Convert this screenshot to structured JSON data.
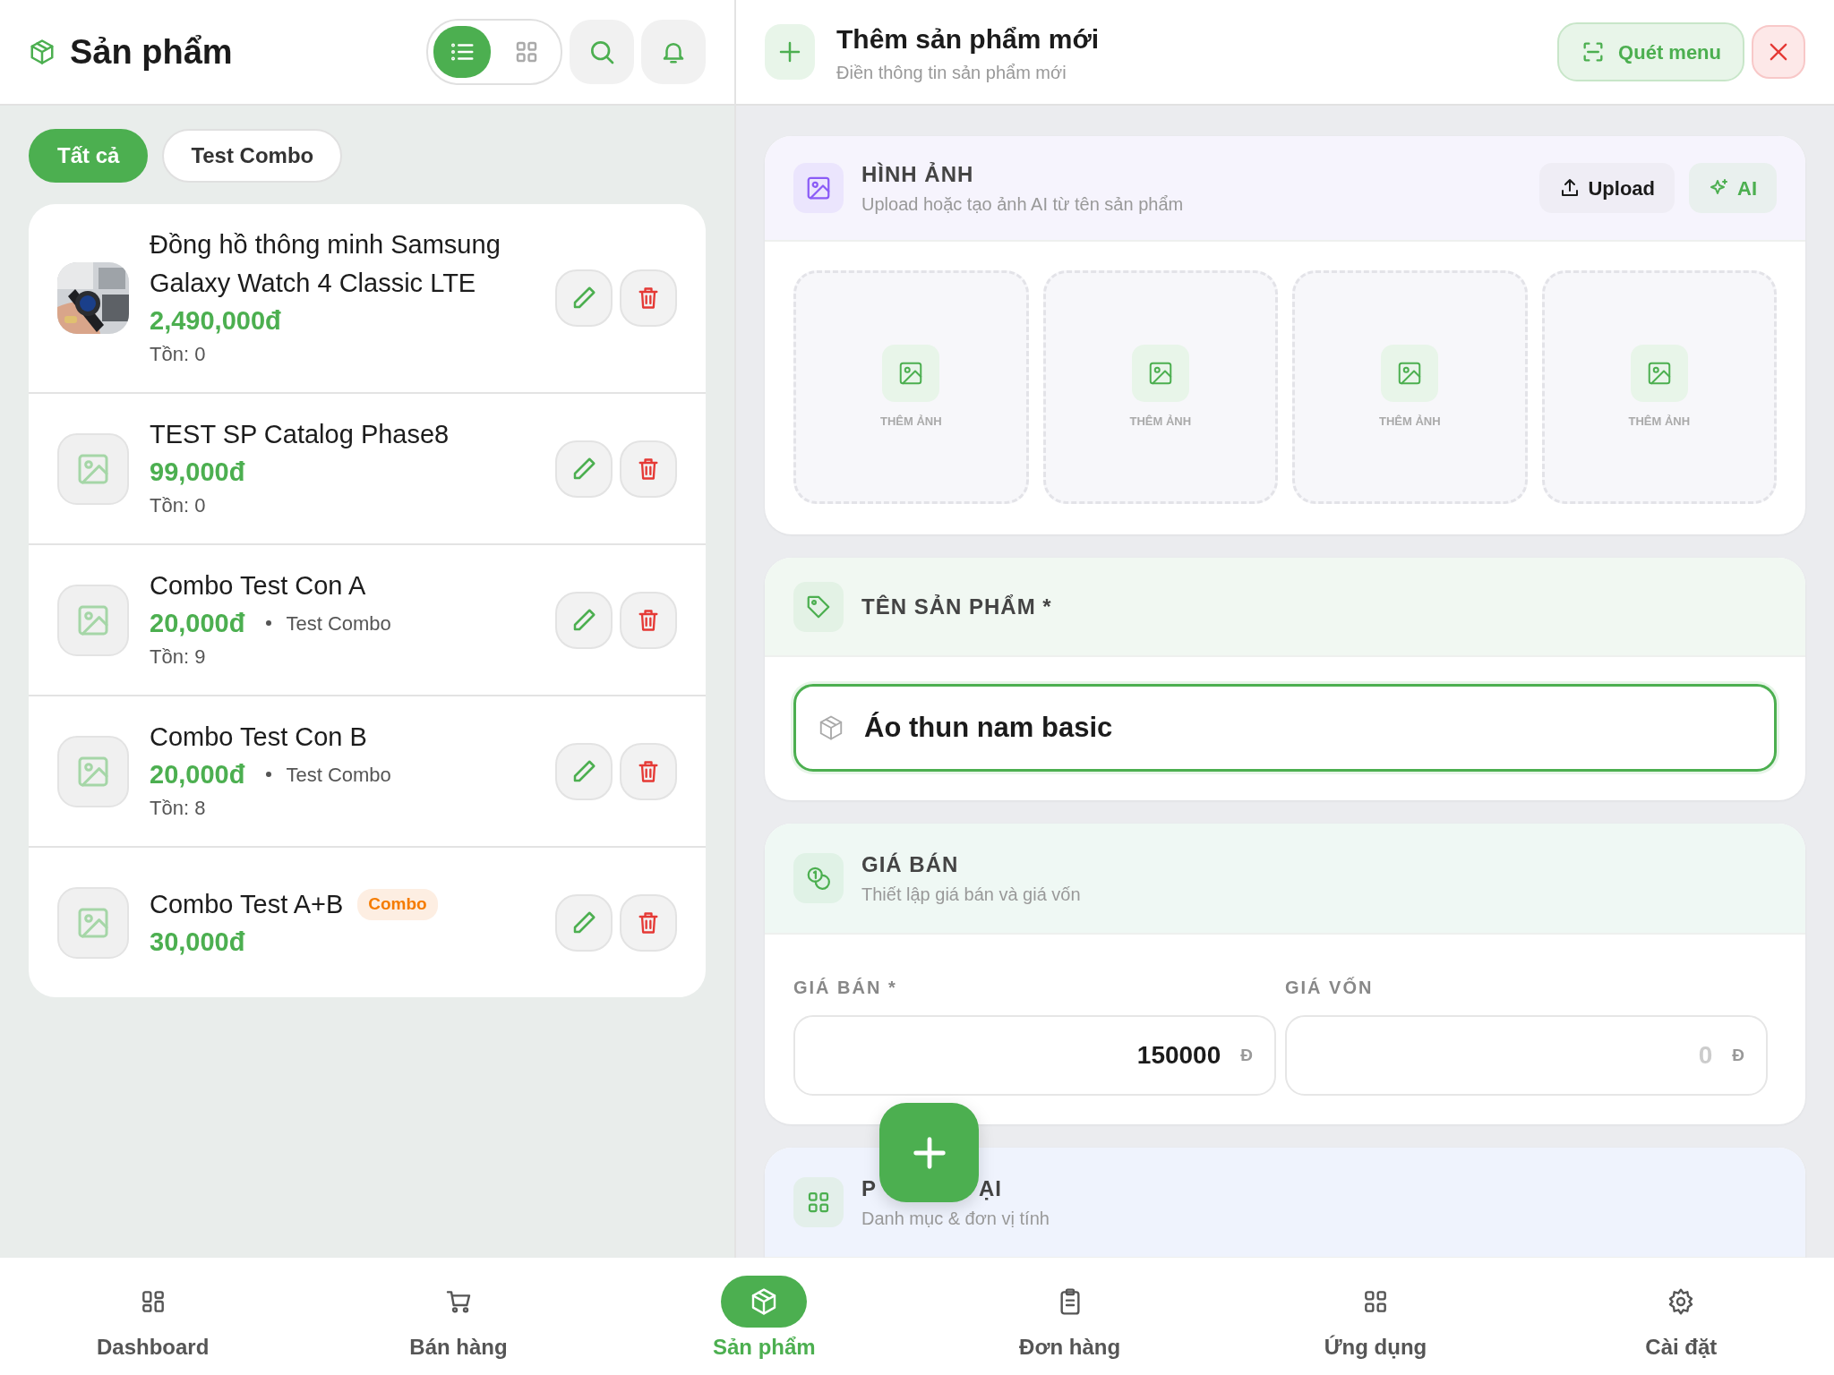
{
  "header": {
    "title": "Sản phẩm",
    "view_modes": [
      {
        "kind": "list",
        "selected": true
      },
      {
        "kind": "grid",
        "selected": false
      }
    ]
  },
  "filters": [
    {
      "label": "Tất cả",
      "selected": true
    },
    {
      "label": "Test Combo",
      "selected": false
    }
  ],
  "products": [
    {
      "name": "Đồng hồ thông minh Samsung Galaxy Watch 4 Classic LTE",
      "price": "2,490,000đ",
      "stock": "Tồn: 0"
    },
    {
      "thumb": {
        "kind": "placeholder"
      },
      "name": "TEST SP Catalog Phase8",
      "price": "99,000đ",
      "stock": "Tồn: 0"
    },
    {
      "thumb": {
        "kind": "placeholder"
      },
      "name": "Combo Test Con A",
      "price": "20,000đ",
      "category": "Test Combo",
      "stock": "Tồn: 9"
    },
    {
      "thumb": {
        "kind": "placeholder"
      },
      "name": "Combo Test Con B",
      "price": "20,000đ",
      "category": "Test Combo",
      "stock": "Tồn: 8"
    },
    {
      "thumb": {
        "kind": "placeholder"
      },
      "name": "Combo Test A+B",
      "badge": "Combo",
      "price": "30,000đ"
    }
  ],
  "form": {
    "title": "Thêm sản phẩm mới",
    "subtitle": "Điền thông tin sản phẩm mới",
    "scan_button": "Quét menu",
    "sections": [
      {
        "kind": "images",
        "title": "HÌNH ẢNH",
        "subtitle": "Upload hoặc tạo ảnh AI từ tên sản phẩm",
        "buttons": [
          "Upload",
          "AI"
        ],
        "slots": [
          "THÊM ẢNH",
          "THÊM ẢNH",
          "THÊM ẢNH",
          "THÊM ẢNH"
        ]
      },
      {
        "kind": "name",
        "title": "TÊN SẢN PHẨM *",
        "value": "Áo thun nam basic"
      },
      {
        "kind": "price",
        "title": "GIÁ BÁN",
        "subtitle": "Thiết lập giá bán và giá vốn",
        "fields": [
          {
            "label": "GIÁ BÁN *",
            "value": "150000",
            "unit": "Đ"
          },
          {
            "label": "GIÁ VỐN",
            "placeholder": "0",
            "unit": "Đ"
          }
        ]
      },
      {
        "kind": "category",
        "title_parts": [
          "P",
          "ẠI"
        ],
        "subtitle": "Danh mục & đơn vị tính"
      }
    ]
  },
  "nav": [
    {
      "kind": "dashboard",
      "label": "Dashboard",
      "selected": false
    },
    {
      "kind": "cart",
      "label": "Bán hàng",
      "selected": false
    },
    {
      "kind": "box",
      "label": "Sản phẩm",
      "selected": true
    },
    {
      "kind": "clipboard",
      "label": "Đơn hàng",
      "selected": false
    },
    {
      "kind": "apps",
      "label": "Ứng dụng",
      "selected": false
    },
    {
      "kind": "gear",
      "label": "Cài đặt",
      "selected": false
    }
  ]
}
